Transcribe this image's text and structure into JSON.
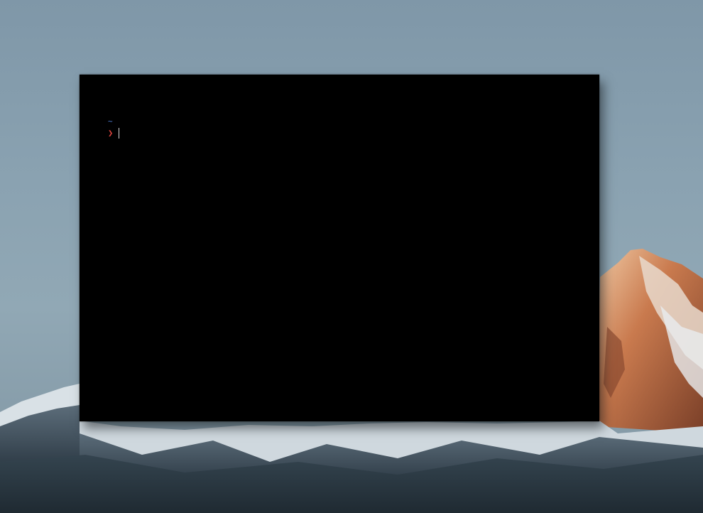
{
  "desktop": {
    "wallpaper": "mountain-landscape",
    "sky_color": "#8aa2b1",
    "snow_color": "#e8ecef",
    "sunlit_rock_color": "#c97a4e"
  },
  "terminal": {
    "background_color": "#000000",
    "cwd": "~",
    "prompt_symbol": "❯",
    "prompt_color": "#e0443e",
    "cwd_color": "#4f7fd8",
    "input_value": ""
  }
}
